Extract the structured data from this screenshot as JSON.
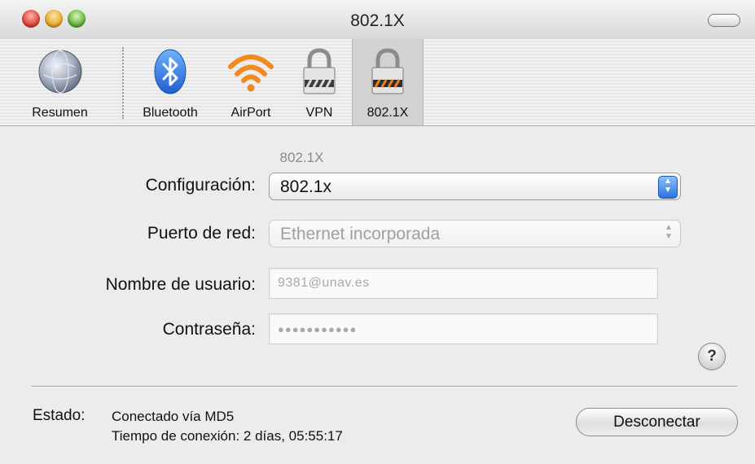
{
  "window": {
    "title": "802.1X"
  },
  "toolbar": {
    "items": [
      {
        "label": "Resumen",
        "icon": "globe-icon"
      },
      {
        "label": "Bluetooth",
        "icon": "bluetooth-icon"
      },
      {
        "label": "AirPort",
        "icon": "airport-wifi-icon"
      },
      {
        "label": "VPN",
        "icon": "padlock-icon"
      },
      {
        "label": "802.1X",
        "icon": "padlock-8021x-icon",
        "selected": true
      }
    ]
  },
  "form": {
    "section_title": "802.1X",
    "configuracion": {
      "label": "Configuración:",
      "value": "802.1x"
    },
    "puerto": {
      "label": "Puerto de red:",
      "value": "Ethernet incorporada"
    },
    "usuario": {
      "label": "Nombre de usuario:",
      "value": "9381@unav.es"
    },
    "contrasena": {
      "label": "Contraseña:",
      "value": "●●●●●●●●●●●"
    }
  },
  "help": {
    "label": "?"
  },
  "status": {
    "label": "Estado:",
    "text": "Conectado vía MD5",
    "connection_time": "Tiempo de conexión: 2 días, 05:55:17"
  },
  "actions": {
    "disconnect_label": "Desconectar"
  }
}
